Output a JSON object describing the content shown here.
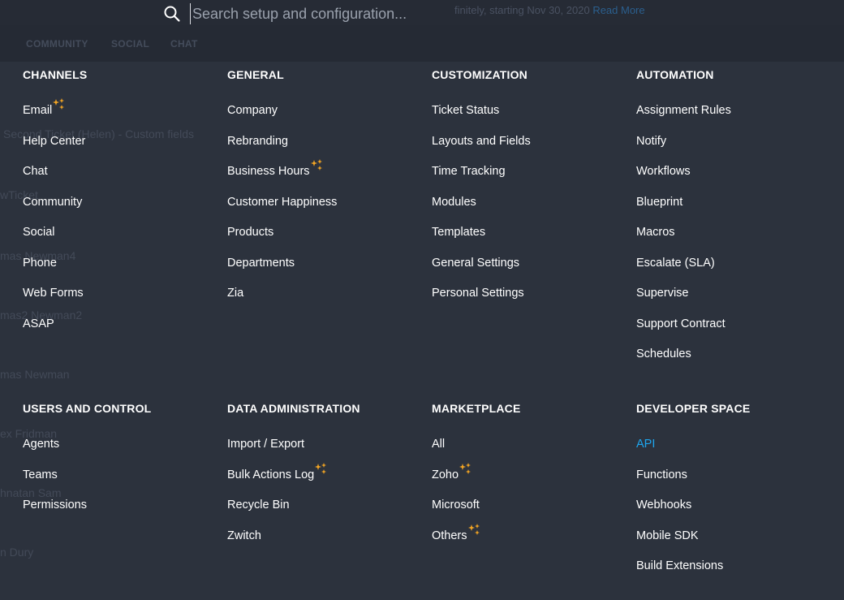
{
  "search": {
    "placeholder": "Search setup and configuration..."
  },
  "background": {
    "notice_text": "finitely, starting Nov 30, 2020",
    "notice_link": "Read More",
    "nav": [
      "COMMUNITY",
      "SOCIAL",
      "CHAT"
    ],
    "rows": [
      "Second Ticket (Helen) - Custom fields",
      "wTicket",
      "mas Newman4",
      "mas2 Newman2",
      "mas Newman",
      "ex Fridman",
      "hnatan Sam",
      "n Dury"
    ]
  },
  "sections": [
    {
      "title": "CHANNELS",
      "items": [
        {
          "label": "Email",
          "new": true
        },
        {
          "label": "Help Center"
        },
        {
          "label": "Chat"
        },
        {
          "label": "Community"
        },
        {
          "label": "Social"
        },
        {
          "label": "Phone"
        },
        {
          "label": "Web Forms"
        },
        {
          "label": "ASAP"
        }
      ]
    },
    {
      "title": "GENERAL",
      "items": [
        {
          "label": "Company"
        },
        {
          "label": "Rebranding"
        },
        {
          "label": "Business Hours",
          "new": true
        },
        {
          "label": "Customer Happiness"
        },
        {
          "label": "Products"
        },
        {
          "label": "Departments"
        },
        {
          "label": "Zia"
        }
      ]
    },
    {
      "title": "CUSTOMIZATION",
      "items": [
        {
          "label": "Ticket Status"
        },
        {
          "label": "Layouts and Fields"
        },
        {
          "label": "Time Tracking"
        },
        {
          "label": "Modules"
        },
        {
          "label": "Templates"
        },
        {
          "label": "General Settings"
        },
        {
          "label": "Personal Settings"
        }
      ]
    },
    {
      "title": "AUTOMATION",
      "items": [
        {
          "label": "Assignment Rules"
        },
        {
          "label": "Notify"
        },
        {
          "label": "Workflows"
        },
        {
          "label": "Blueprint"
        },
        {
          "label": "Macros"
        },
        {
          "label": "Escalate (SLA)"
        },
        {
          "label": "Supervise"
        },
        {
          "label": "Support Contract"
        },
        {
          "label": "Schedules"
        }
      ]
    },
    {
      "title": "USERS AND CONTROL",
      "items": [
        {
          "label": "Agents"
        },
        {
          "label": "Teams"
        },
        {
          "label": "Permissions"
        }
      ]
    },
    {
      "title": "DATA ADMINISTRATION",
      "items": [
        {
          "label": "Import / Export"
        },
        {
          "label": "Bulk Actions Log",
          "new": true
        },
        {
          "label": "Recycle Bin"
        },
        {
          "label": "Zwitch"
        }
      ]
    },
    {
      "title": "MARKETPLACE",
      "items": [
        {
          "label": "All"
        },
        {
          "label": "Zoho",
          "new": true
        },
        {
          "label": "Microsoft"
        },
        {
          "label": "Others",
          "new": true
        }
      ]
    },
    {
      "title": "DEVELOPER SPACE",
      "items": [
        {
          "label": "API",
          "link": true
        },
        {
          "label": "Functions"
        },
        {
          "label": "Webhooks"
        },
        {
          "label": "Mobile SDK"
        },
        {
          "label": "Build Extensions"
        }
      ]
    }
  ],
  "colors": {
    "background": "#2c323d",
    "text": "#ffffff",
    "link": "#1ea6ef",
    "sparkle": "#f5a623"
  },
  "icons": {
    "search": "search-icon",
    "new_badge": "sparkle-icon"
  }
}
